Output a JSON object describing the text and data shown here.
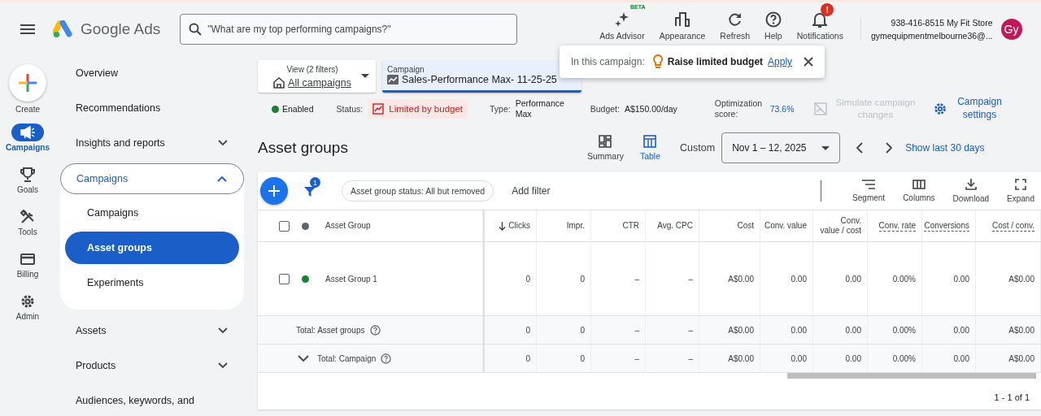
{
  "header": {
    "logo_text": "Google Ads",
    "search": {
      "placeholder": "\"What are my top performing campaigns?\""
    },
    "tools": [
      {
        "kind": "advisor",
        "label": "Ads Advisor",
        "badge": "BETA"
      },
      {
        "kind": "appearance",
        "label": "Appearance"
      },
      {
        "kind": "refresh",
        "label": "Refresh"
      },
      {
        "kind": "help",
        "label": "Help"
      },
      {
        "kind": "notifications",
        "label": "Notifications",
        "alert": "!"
      }
    ],
    "account": {
      "name": "938-416-8515 My Fit Store",
      "email": "gymequipmentmelbourne36@...",
      "avatar": "Gy"
    }
  },
  "rail": {
    "create": "Create",
    "items": [
      {
        "kind": "campaigns",
        "label": "Campaigns",
        "selected": true
      },
      {
        "kind": "goals",
        "label": "Goals",
        "selected": false
      },
      {
        "kind": "tools",
        "label": "Tools",
        "selected": false
      },
      {
        "kind": "billing",
        "label": "Billing",
        "selected": false
      },
      {
        "kind": "admin",
        "label": "Admin",
        "selected": false
      }
    ]
  },
  "nav": [
    {
      "kind": "link",
      "label": "Overview"
    },
    {
      "kind": "link",
      "label": "Recommendations"
    },
    {
      "kind": "group",
      "label": "Insights and reports",
      "expanded": false
    },
    {
      "kind": "group",
      "label": "Campaigns",
      "expanded": true,
      "children": [
        {
          "label": "Campaigns",
          "selected": false
        },
        {
          "label": "Asset groups",
          "selected": true
        },
        {
          "label": "Experiments",
          "selected": false
        }
      ]
    },
    {
      "kind": "group",
      "label": "Assets",
      "expanded": false
    },
    {
      "kind": "group",
      "label": "Products",
      "expanded": false
    },
    {
      "kind": "link",
      "label": "Audiences, keywords, and"
    }
  ],
  "selectors": [
    {
      "kind": "view",
      "label": "View (2 filters)",
      "value": "All campaigns"
    },
    {
      "kind": "campaign",
      "label": "Campaign",
      "value": "Sales-Performance Max- 11-25-25"
    }
  ],
  "tip": {
    "prefix": "In this campaign:",
    "text": "Raise limited budget",
    "action": "Apply"
  },
  "summary": {
    "state": "Enabled",
    "enabled": true,
    "status_label": "Status:",
    "status": "Limited by budget",
    "type_label": "Type:",
    "type": "Performance Max",
    "budget_label": "Budget:",
    "budget": "A$150.00/day",
    "score_label": "Optimization score:",
    "score": "73.6%",
    "simulate": {
      "label": "Simulate campaign changes",
      "disabled": true
    },
    "settings": "Campaign settings"
  },
  "page": {
    "title": "Asset groups",
    "views": [
      {
        "kind": "summary",
        "label": "Summary",
        "selected": false
      },
      {
        "kind": "table",
        "label": "Table",
        "selected": true
      }
    ],
    "range_label": "Custom",
    "range": "Nov 1 – 12, 2025",
    "last30": "Show last 30 days"
  },
  "toolbar": {
    "filter_count": "1",
    "chip": "Asset group status: All but removed",
    "add_filter": "Add filter",
    "actions": [
      {
        "kind": "segment",
        "label": "Segment"
      },
      {
        "kind": "columns",
        "label": "Columns"
      },
      {
        "kind": "download",
        "label": "Download"
      },
      {
        "kind": "expand",
        "label": "Expand"
      }
    ]
  },
  "table": {
    "header_checked": false,
    "columns": [
      {
        "label": "Asset Group",
        "sorted": false,
        "underline": false
      },
      {
        "label": "Clicks",
        "sorted": true,
        "underline": false
      },
      {
        "label": "Impr.",
        "sorted": false,
        "underline": false
      },
      {
        "label": "CTR",
        "sorted": false,
        "underline": false
      },
      {
        "label": "Avg. CPC",
        "sorted": false,
        "underline": false
      },
      {
        "label": "Cost",
        "sorted": false,
        "underline": false
      },
      {
        "label": "Conv. value",
        "sorted": false,
        "underline": false
      },
      {
        "label": "Conv. value / cost",
        "sorted": false,
        "underline": false
      },
      {
        "label": "Conv. rate",
        "sorted": false,
        "underline": true
      },
      {
        "label": "Conversions",
        "sorted": false,
        "underline": true
      },
      {
        "label": "Cost / conv.",
        "sorted": false,
        "underline": true
      }
    ],
    "rows": [
      {
        "kind": "data",
        "checked": false,
        "color": "#188038",
        "name": "Asset Group 1",
        "values": [
          "0",
          "0",
          "–",
          "–",
          "A$0.00",
          "0.00",
          "0.00",
          "0.00%",
          "0.00",
          "A$0.00"
        ]
      },
      {
        "kind": "total",
        "name": "Total: Asset groups",
        "values": [
          "0",
          "0",
          "–",
          "–",
          "A$0.00",
          "0.00",
          "0.00",
          "0.00%",
          "0.00",
          "A$0.00"
        ]
      },
      {
        "kind": "total",
        "expanded": false,
        "name": "Total: Campaign",
        "values": [
          "0",
          "0",
          "–",
          "–",
          "A$0.00",
          "0.00",
          "0.00",
          "0.00%",
          "0.00",
          "A$0.00"
        ]
      }
    ],
    "pagination": "1 - 1 of 1"
  }
}
